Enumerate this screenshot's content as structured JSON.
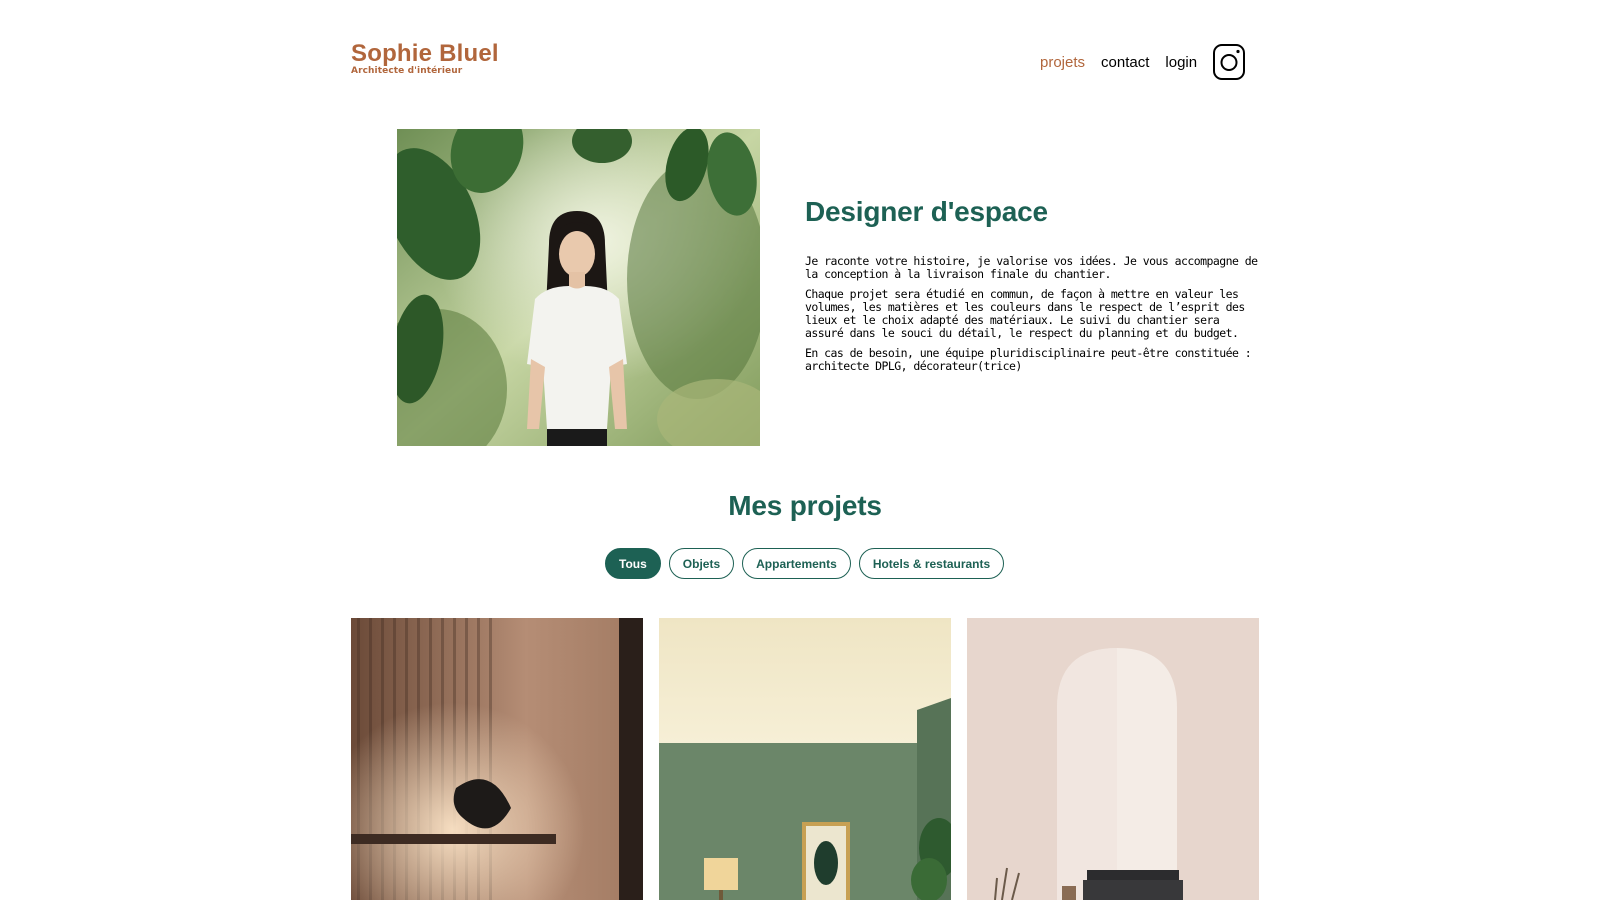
{
  "header": {
    "logo_name": "Sophie Bluel",
    "logo_subtitle": "Architecte d'intérieur",
    "nav": [
      {
        "label": "projets",
        "active": true
      },
      {
        "label": "contact",
        "active": false
      },
      {
        "label": "login",
        "active": false
      }
    ],
    "social_icon": "instagram-icon"
  },
  "intro": {
    "title": "Designer d'espace",
    "paragraphs": [
      "Je raconte votre histoire, je valorise vos idées. Je vous accompagne de la conception à la livraison finale du chantier.",
      "Chaque projet sera étudié en commun, de façon à mettre en valeur les volumes, les matières et les couleurs dans le respect de l’esprit des lieux et le choix adapté des matériaux. Le suivi du chantier sera assuré dans le souci du détail, le respect du planning et du budget.",
      "En cas de besoin, une équipe pluridisciplinaire peut-être constituée : architecte DPLG, décorateur(trice)"
    ]
  },
  "portfolio": {
    "title": "Mes projets",
    "filters": [
      {
        "label": "Tous",
        "active": true
      },
      {
        "label": "Objets",
        "active": false
      },
      {
        "label": "Appartements",
        "active": false
      },
      {
        "label": "Hotels & restaurants",
        "active": false
      }
    ]
  },
  "colors": {
    "brand": "#B1663C",
    "accent": "#1D6154"
  }
}
